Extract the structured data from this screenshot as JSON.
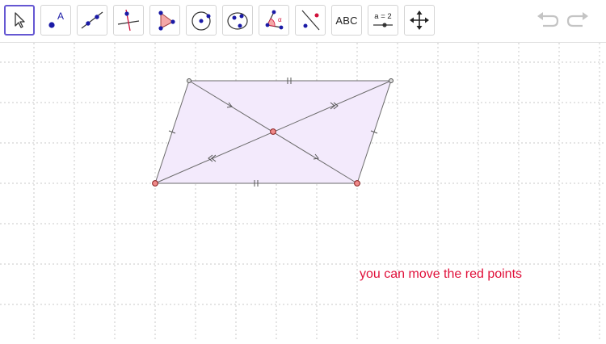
{
  "toolbar": {
    "tools": [
      {
        "name": "move",
        "icon": "arrow-cursor-icon"
      },
      {
        "name": "point",
        "icon": "point-icon",
        "label": "A"
      },
      {
        "name": "line",
        "icon": "line-through-points-icon"
      },
      {
        "name": "perpendicular-line",
        "icon": "perpendicular-line-icon"
      },
      {
        "name": "polygon",
        "icon": "polygon-icon"
      },
      {
        "name": "circle",
        "icon": "circle-center-point-icon"
      },
      {
        "name": "ellipse",
        "icon": "circle-three-points-icon"
      },
      {
        "name": "angle",
        "icon": "angle-icon",
        "label": "α"
      },
      {
        "name": "reflect",
        "icon": "reflect-about-line-icon"
      },
      {
        "name": "text",
        "icon": "text-icon",
        "label": "ABC"
      },
      {
        "name": "slider",
        "icon": "slider-icon",
        "label": "a = 2"
      },
      {
        "name": "move-graphics",
        "icon": "move-graphics-view-icon"
      }
    ],
    "undo_icon": "undo-icon",
    "redo_icon": "redo-icon"
  },
  "canvas": {
    "note": "you can move the red points",
    "colors": {
      "grid": "#c8c8c8",
      "fill": "#f3eafc",
      "edge": "#6b6b6b",
      "red_point": "#f08a8a",
      "note_text": "#e0103a"
    }
  }
}
